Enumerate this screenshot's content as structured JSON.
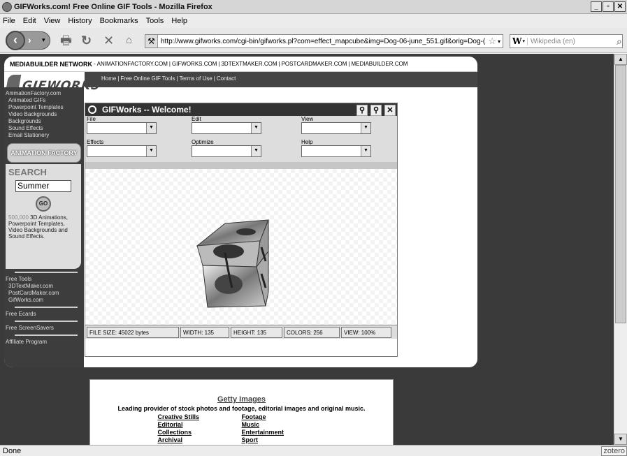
{
  "window": {
    "title": "GIFWorks.com! Free Online GIF Tools - Mozilla Firefox",
    "min": "_",
    "max": "▫",
    "close": "✕"
  },
  "menubar": [
    "File",
    "Edit",
    "View",
    "History",
    "Bookmarks",
    "Tools",
    "Help"
  ],
  "navbar": {
    "url": "http://www.gifworks.com/cgi-bin/gifworks.pl?com=effect_mapcube&img=Dog-06-june_551.gif&orig=Dog-(",
    "search_engine": "W",
    "search_placeholder": "Wikipedia (en)"
  },
  "page": {
    "network": {
      "label": "MEDIABUILDER NETWORK",
      "dash": " - ",
      "links": [
        "ANIMATIONFACTORY.COM",
        "GIFWORKS.COM",
        "3DTEXTMAKER.COM",
        "POSTCARDMAKER.COM",
        "MEDIABUILDER.COM"
      ],
      "sep": "|"
    },
    "brand": {
      "logo_text": "GIFWORKS",
      "links": [
        "Home",
        "Free Online GIF Tools",
        "Terms of Use",
        "Contact"
      ]
    },
    "sidebar": {
      "top_links": [
        "AnimationFactory.com",
        "Animated GIFs",
        "Powerpoint Templates",
        "Video Backgrounds",
        "Backgrounds",
        "Sound Effects",
        "Email Stationery"
      ],
      "banner": "ANIMATION FACTORY",
      "search_title": "SEARCH",
      "search_value": "Summer",
      "go_label": "GO",
      "desc_num": "500,000",
      "desc_text": " 3D Animations, Powerpoint Templates, Video Backgrounds and Sound Effects.",
      "free_tools_label": "Free Tools",
      "free_tools": [
        "3DTextMaker.com",
        "PostCardMaker.com",
        "GifWorks.com"
      ],
      "free_ecards": "Free Ecards",
      "free_screensavers": "Free ScreenSavers",
      "affiliate": "Affiliate Program"
    },
    "gifworks": {
      "title": "GIFWorks -- Welcome!",
      "menus": [
        "File",
        "Edit",
        "View",
        "Effects",
        "Optimize",
        "Help"
      ],
      "status": {
        "file_size": "FILE SIZE: 45022 bytes",
        "width": "WIDTH: 135",
        "height": "HEIGHT: 135",
        "colors": "COLORS: 256",
        "view": "VIEW: 100%"
      }
    },
    "getty": {
      "title": "Getty Images",
      "subtitle": "Leading provider of stock photos and footage, editorial images and original music.",
      "col1": [
        "Creative Stills",
        "Editorial",
        "Collections",
        "Archival"
      ],
      "col2": [
        "Footage",
        "Music",
        "Entertainment",
        "Sport"
      ]
    }
  },
  "status": {
    "text": "Done",
    "zotero": "zotero"
  }
}
